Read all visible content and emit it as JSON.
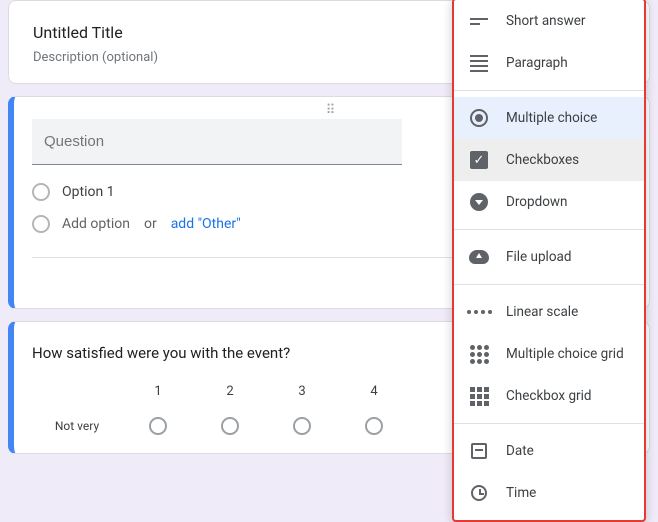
{
  "titleCard": {
    "title": "Untitled Title",
    "description": "Description (optional)"
  },
  "questionEditor": {
    "placeholder": "Question",
    "options": [
      "Option 1"
    ],
    "addOption": "Add option",
    "or": "or",
    "addOther": "add \"Other\""
  },
  "linearScaleCard": {
    "question": "How satisfied were you with the event?",
    "lowLabel": "Not very",
    "scale": [
      "1",
      "2",
      "3",
      "4"
    ]
  },
  "typeMenu": {
    "items": [
      {
        "label": "Short answer",
        "icon": "short-answer"
      },
      {
        "label": "Paragraph",
        "icon": "paragraph"
      },
      {
        "sep": true
      },
      {
        "label": "Multiple choice",
        "icon": "radio",
        "state": "selected"
      },
      {
        "label": "Checkboxes",
        "icon": "checkbox",
        "state": "hover"
      },
      {
        "label": "Dropdown",
        "icon": "dropdown"
      },
      {
        "sep": true
      },
      {
        "label": "File upload",
        "icon": "upload"
      },
      {
        "sep": true
      },
      {
        "label": "Linear scale",
        "icon": "linear-scale"
      },
      {
        "label": "Multiple choice grid",
        "icon": "dot-grid"
      },
      {
        "label": "Checkbox grid",
        "icon": "square-grid"
      },
      {
        "sep": true
      },
      {
        "label": "Date",
        "icon": "date"
      },
      {
        "label": "Time",
        "icon": "time"
      }
    ]
  }
}
